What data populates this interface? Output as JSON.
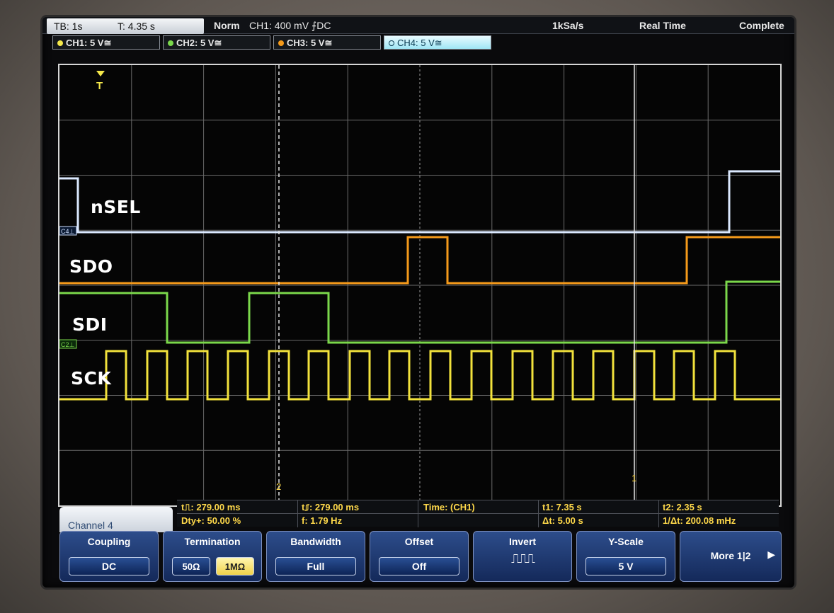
{
  "status_bar": {
    "timebase": "TB: 1s",
    "trigger_time": "T: 4.35 s",
    "trigger_mode": "Norm",
    "trigger_source": "CH1: 400 mV ⨍DC",
    "sample_rate": "1kSa/s",
    "acq_mode": "Real Time",
    "acq_status": "Complete"
  },
  "channels": [
    {
      "label": "CH1: 5 V≅",
      "color": "#f5e84a"
    },
    {
      "label": "CH2: 5 V≅",
      "color": "#7bd84b"
    },
    {
      "label": "CH3: 5 V≅",
      "color": "#f59a1a"
    },
    {
      "label": "CH4: 5 V≅",
      "color": "#8fd6f0",
      "active": true
    }
  ],
  "signals": [
    {
      "name": "nSEL",
      "channel": "CH4",
      "color": "#dbe9ff",
      "marker": "C4⊥"
    },
    {
      "name": "SDO",
      "channel": "CH3",
      "color": "#f59a1a"
    },
    {
      "name": "SDI",
      "channel": "CH2",
      "color": "#7bd84b",
      "marker": "C2⊥"
    },
    {
      "name": "SCK",
      "channel": "CH1",
      "color": "#f2e23c"
    }
  ],
  "cursor_markers": {
    "c1": "1",
    "c2": "2"
  },
  "trigger_marker": "T",
  "measurements": {
    "pos_pulse": "t⎍: 279.00 ms",
    "neg_pulse": "t⎎: 279.00 ms",
    "duty": "Dty+: 50.00 %",
    "freq": "f: 1.79 Hz",
    "time_label": "Time:  (CH1)",
    "t1": "t1: 7.35 s",
    "t2": "t2: 2.35 s",
    "delta_t": "Δt: 5.00 s",
    "inv_delta_t": "1/Δt: 200.08 mHz"
  },
  "menu": {
    "title": "Channel 4",
    "coupling": {
      "title": "Coupling",
      "value": "DC"
    },
    "termination": {
      "title": "Termination",
      "opt1": "50Ω",
      "opt2": "1MΩ"
    },
    "bandwidth": {
      "title": "Bandwidth",
      "value": "Full"
    },
    "offset": {
      "title": "Offset",
      "value": "Off"
    },
    "invert": {
      "title": "Invert",
      "value": "⎍⎍⎍"
    },
    "y_scale": {
      "title": "Y-Scale",
      "value": "5 V"
    },
    "more": {
      "title": "More 1|2",
      "arrow": "▶"
    }
  }
}
